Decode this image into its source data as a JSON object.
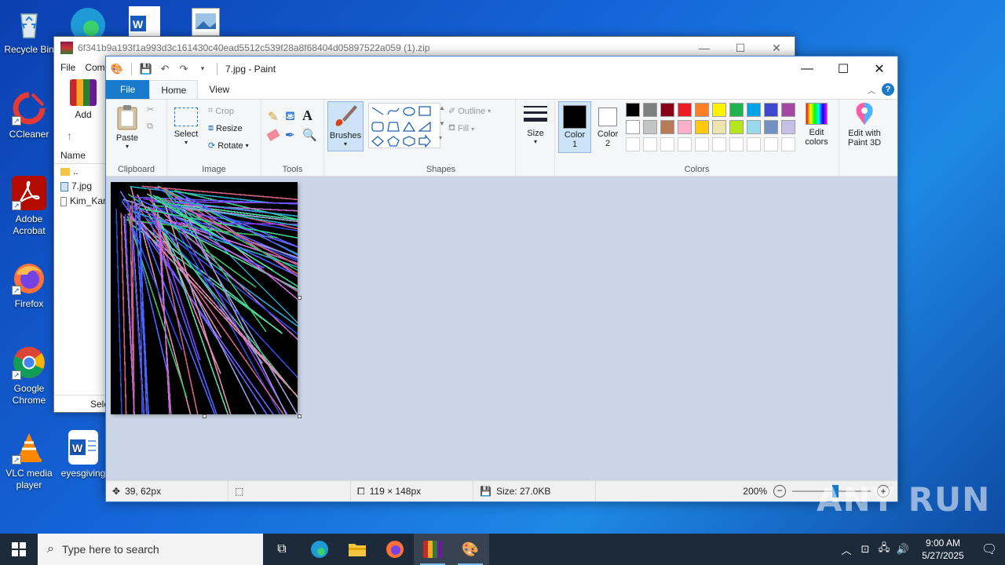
{
  "desktop": {
    "icons": [
      {
        "label": "Recycle Bin",
        "icon": "recycle-bin-icon"
      },
      {
        "label": "CCleaner",
        "icon": "ccleaner-icon"
      },
      {
        "label": "Adobe Acrobat",
        "icon": "adobe-acrobat-icon"
      },
      {
        "label": "Firefox",
        "icon": "firefox-icon"
      },
      {
        "label": "Google Chrome",
        "icon": "chrome-icon"
      },
      {
        "label": "VLC media player",
        "icon": "vlc-icon"
      },
      {
        "label": "eyesgiving",
        "icon": "word-doc-icon"
      }
    ]
  },
  "winrar": {
    "title": "6f341b9a193f1a993d3c161430c40ead5512c539f28a8f68404d05897522a059 (1).zip",
    "menu": [
      "File",
      "Com"
    ],
    "add_label": "Add",
    "list_header": "Name",
    "files": [
      "..",
      "7.jpg",
      "Kim_Kar"
    ],
    "status": "Sele"
  },
  "paint": {
    "title": "7.jpg - Paint",
    "tabs": {
      "file": "File",
      "home": "Home",
      "view": "View"
    },
    "clipboard": {
      "paste": "Paste",
      "group": "Clipboard"
    },
    "image": {
      "select": "Select",
      "crop": "Crop",
      "resize": "Resize",
      "rotate": "Rotate",
      "group": "Image"
    },
    "tools": {
      "group": "Tools"
    },
    "brushes": "Brushes",
    "shapes": {
      "outline": "Outline",
      "fill": "Fill",
      "group": "Shapes"
    },
    "size": "Size",
    "color1": {
      "label": "Color",
      "num": "1",
      "value": "#000000"
    },
    "color2": {
      "label": "Color",
      "num": "2",
      "value": "#ffffff"
    },
    "colors_group": "Colors",
    "edit_colors": {
      "line1": "Edit",
      "line2": "colors"
    },
    "paint3d": {
      "line1": "Edit with",
      "line2": "Paint 3D"
    },
    "palette_row1": [
      "#000000",
      "#7f7f7f",
      "#880015",
      "#ed1c24",
      "#ff7f27",
      "#fff200",
      "#22b14c",
      "#00a2e8",
      "#3f48cc",
      "#a349a4"
    ],
    "palette_row2": [
      "#ffffff",
      "#c3c3c3",
      "#b97a57",
      "#ffaec9",
      "#ffc90e",
      "#efe4b0",
      "#b5e61d",
      "#99d9ea",
      "#7092be",
      "#c8bfe7"
    ],
    "palette_row3": [
      "#ffffff",
      "#ffffff",
      "#ffffff",
      "#ffffff",
      "#ffffff",
      "#ffffff",
      "#ffffff",
      "#ffffff",
      "#ffffff",
      "#ffffff"
    ],
    "status": {
      "cursor_pos": "39, 62px",
      "selection_size": "",
      "image_size": "119 × 148px",
      "file_size": "Size: 27.0KB",
      "zoom": "200%",
      "zoom_fraction": 0.55
    }
  },
  "taskbar": {
    "search_placeholder": "Type here to search",
    "time": "9:00 AM",
    "date": "5/27/2025"
  },
  "watermark": "ANY RUN"
}
